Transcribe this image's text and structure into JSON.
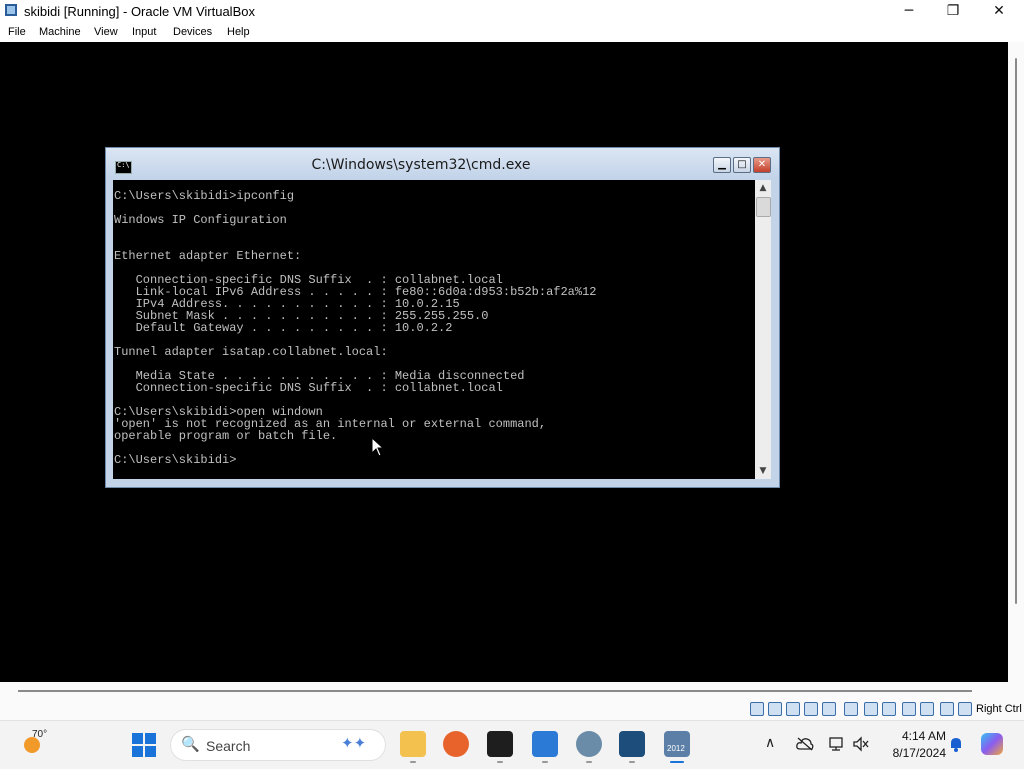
{
  "window": {
    "title": "skibidi [Running] - Oracle VM VirtualBox",
    "minimize_glyph": "─",
    "maximize_glyph": "❐",
    "close_glyph": "✕"
  },
  "menu": {
    "items": [
      {
        "label": "File"
      },
      {
        "label": "Machine"
      },
      {
        "label": "View"
      },
      {
        "label": "Input"
      },
      {
        "label": "Devices"
      },
      {
        "label": "Help"
      }
    ]
  },
  "cmd": {
    "title": "C:\\Windows\\system32\\cmd.exe",
    "icon_text": "C:\\",
    "minimize_glyph": "▁",
    "maximize_glyph": "□",
    "close_glyph": "✕",
    "console_text": "C:\\Users\\skibidi>ipconfig\n\nWindows IP Configuration\n\n\nEthernet adapter Ethernet:\n\n   Connection-specific DNS Suffix  . : collabnet.local\n   Link-local IPv6 Address . . . . . : fe80::6d0a:d953:b52b:af2a%12\n   IPv4 Address. . . . . . . . . . . : 10.0.2.15\n   Subnet Mask . . . . . . . . . . . : 255.255.255.0\n   Default Gateway . . . . . . . . . : 10.0.2.2\n\nTunnel adapter isatap.collabnet.local:\n\n   Media State . . . . . . . . . . . : Media disconnected\n   Connection-specific DNS Suffix  . : collabnet.local\n\nC:\\Users\\skibidi>open windown\n'open' is not recognized as an internal or external command,\noperable program or batch file.\n\nC:\\Users\\skibidi>",
    "scroll_up": "▲",
    "scroll_down": "▼"
  },
  "status_bar": {
    "icons": [
      "hard-disk-icon",
      "optical-drive-icon",
      "floppy-icon",
      "audio-icon",
      "network-icon",
      "usb-icon",
      "shared-folders-icon",
      "display-icon",
      "recording-icon",
      "cpu-icon",
      "mouse-integration-icon",
      "keyboard-icon"
    ],
    "host_key": "Right Ctrl"
  },
  "taskbar": {
    "weather_temp": "70°",
    "search_placeholder": "Search",
    "search_glyph": "🔍",
    "sparkle_glyph": "✦✦",
    "apps": [
      {
        "name": "file-explorer-icon",
        "color": "#f2c14e"
      },
      {
        "name": "firefox-icon",
        "color": "#e8632b"
      },
      {
        "name": "terminal-icon",
        "color": "#1e1e1e"
      },
      {
        "name": "notepad-icon",
        "color": "#2b7bd6"
      },
      {
        "name": "settings-app-icon",
        "color": "#6a8ca8"
      },
      {
        "name": "virtualbox-icon",
        "color": "#1d4d7a"
      },
      {
        "name": "server-2012-icon",
        "color": "#5b7fa6"
      }
    ],
    "server_label": "2012",
    "tray": {
      "chevron": "∧",
      "time": "4:14 AM",
      "date": "8/17/2024"
    }
  },
  "colors": {
    "accent": "#1a73d9",
    "console_bg": "#000000",
    "console_fg": "#c0c0c0"
  }
}
